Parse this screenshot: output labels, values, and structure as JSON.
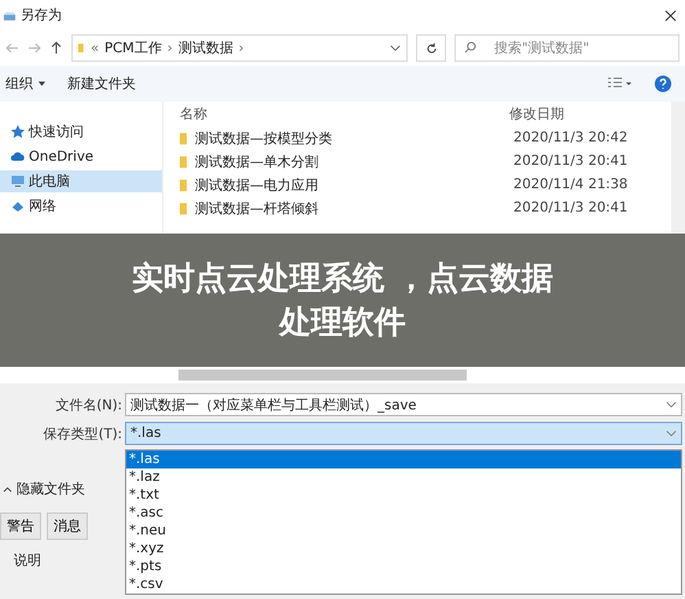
{
  "window": {
    "title": "另存为"
  },
  "address": {
    "prefix": "«",
    "separator": "›",
    "crumbs": [
      "PCM工作",
      "测试数据"
    ],
    "search_placeholder": "搜索\"测试数据\""
  },
  "toolbar": [
    {
      "label": "组织",
      "has_menu": true
    },
    {
      "label": "新建文件夹",
      "has_menu": false
    }
  ],
  "sidebar": {
    "items": [
      {
        "label": "快速访问",
        "kind": "star",
        "selected": false
      },
      {
        "label": "OneDrive",
        "kind": "cloud",
        "selected": false
      },
      {
        "label": "此电脑",
        "kind": "pc",
        "selected": true
      },
      {
        "label": "网络",
        "kind": "net",
        "selected": false
      }
    ]
  },
  "table": {
    "columns": [
      "名称",
      "修改日期"
    ],
    "rows": [
      {
        "name": "测试数据—按模型分类",
        "date": "2020/11/3 20:42"
      },
      {
        "name": "测试数据—单木分割",
        "date": "2020/11/3 20:41"
      },
      {
        "name": "测试数据—电力应用",
        "date": "2020/11/4 21:38"
      },
      {
        "name": "测试数据—杆塔倾斜",
        "date": "2020/11/3 20:41"
      }
    ]
  },
  "banner": {
    "lines": [
      "实时点云处理系统 ，点云数据",
      "处理软件"
    ]
  },
  "file_name": {
    "label": "文件名(N):",
    "value": "测试数据一（对应菜单栏与工具栏测试）_save"
  },
  "file_type": {
    "label": "保存类型(T):",
    "value": "*.las",
    "options": [
      {
        "label": "*.las",
        "selected": true
      },
      {
        "label": "*.laz",
        "selected": false
      },
      {
        "label": "*.txt",
        "selected": false
      },
      {
        "label": "*.asc",
        "selected": false
      },
      {
        "label": "*.neu",
        "selected": false
      },
      {
        "label": "*.xyz",
        "selected": false
      },
      {
        "label": "*.pts",
        "selected": false
      },
      {
        "label": "*.csv",
        "selected": false
      }
    ]
  },
  "hide_folders": "隐藏文件夹",
  "background": {
    "tabs": [
      "警告",
      "消息"
    ],
    "column": "说明"
  }
}
